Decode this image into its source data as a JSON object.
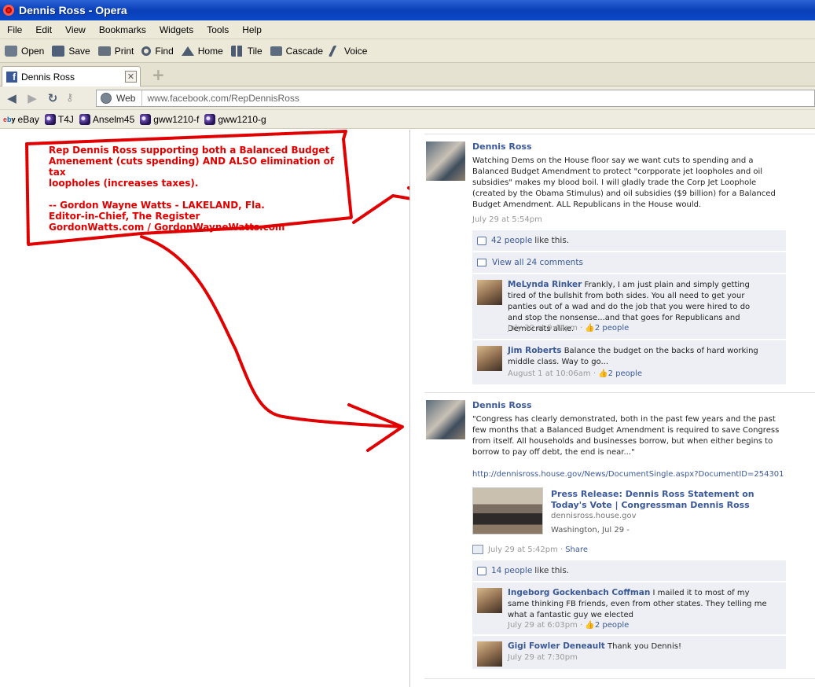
{
  "window": {
    "title": "Dennis Ross - Opera"
  },
  "menu": [
    "File",
    "Edit",
    "View",
    "Bookmarks",
    "Widgets",
    "Tools",
    "Help"
  ],
  "toolbar": {
    "open": "Open",
    "save": "Save",
    "print": "Print",
    "find": "Find",
    "home": "Home",
    "tile": "Tile",
    "cascade": "Cascade",
    "voice": "Voice"
  },
  "tab": {
    "label": "Dennis Ross"
  },
  "address": {
    "badge": "Web",
    "url": "www.facebook.com/RepDennisRoss"
  },
  "bookmarks": [
    "eBay",
    "T4J",
    "Anselm45",
    "gww1210-f",
    "gww1210-g"
  ],
  "annotation": {
    "line1": "Rep Dennis Ross supporting both a Balanced Budget",
    "line2": "Amenement (cuts spending) AND ALSO elimination of tax",
    "line3": "loopholes (increases taxes).",
    "line4": "-- Gordon Wayne Watts - LAKELAND, Fla.",
    "line5": "Editor-in-Chief, The Register",
    "line6": "GordonWatts.com / GordonWayneWatts.com",
    "color": "#e00000"
  },
  "posts": [
    {
      "author": "Dennis Ross",
      "message": "Watching Dems on the House floor say we want cuts to spending and a Balanced Budget Amendment to protect \"corpporate jet loopholes and oil subsidies\" makes my blood boil. I will gladly trade the Corp Jet Loophole (created by the Obama Stimulus) and oil subsidies ($9 billion) for a Balanced Budget Amendment. ALL Republicans in the House would.",
      "time": "July 29 at 5:54pm",
      "likes_count": "42 people",
      "likes_suffix": "like this.",
      "view_comments": "View all 24 comments",
      "comments": [
        {
          "author": "MeLynda Rinker",
          "text": "Frankly, I am just plain and simply getting tired of the bullshit from both sides. You all need to get your panties out of a wad and do the job that you were hired to do and stop the nonsense...and that goes for Republicans and Democrats alike.",
          "time": "July 30 at 9:44pm",
          "likes": "2 people"
        },
        {
          "author": "Jim Roberts",
          "text": "Balance the budget on the backs of hard working middle class. Way to go...",
          "time": "August 1 at 10:06am",
          "likes": "2 people"
        }
      ]
    },
    {
      "author": "Dennis Ross",
      "message": "\"Congress has clearly demonstrated, both in the past few years and the past few months that a Balanced Budget Amendment is required to save Congress from itself. All households and businesses borrow, but when either begins to borrow to pay off debt, the end is near...\"",
      "link_url": "http://dennisross.house.gov/News/DocumentSingle.aspx?DocumentID=254301",
      "share": {
        "title": "Press Release: Dennis Ross Statement on Today's Vote | Congressman Dennis Ross",
        "domain": "dennisross.house.gov",
        "desc": "Washington, Jul 29 -"
      },
      "time": "July 29 at 5:42pm",
      "share_label": "Share",
      "likes_count": "14 people",
      "likes_suffix": "like this.",
      "comments": [
        {
          "author": "Ingeborg Gockenbach Coffman",
          "text": "I mailed it to most of my same thinking FB friends, even from other states. They telling me what a fantastic guy we elected",
          "time": "July 29 at 6:03pm",
          "likes": "2 people"
        },
        {
          "author": "Gigi Fowler Deneault",
          "text": "Thank you Dennis!",
          "time": "July 29 at 7:30pm"
        }
      ]
    }
  ]
}
